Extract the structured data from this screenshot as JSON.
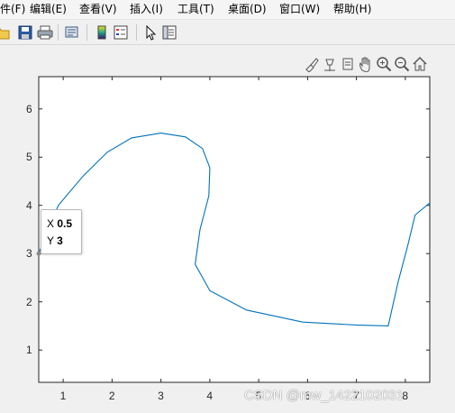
{
  "menu": [
    {
      "label": "件(F)"
    },
    {
      "label": "编辑(E)"
    },
    {
      "label": "查看(V)"
    },
    {
      "label": "插入(I)"
    },
    {
      "label": "工具(T)"
    },
    {
      "label": "桌面(D)"
    },
    {
      "label": "窗口(W)"
    },
    {
      "label": "帮助(H)"
    }
  ],
  "toolbar": {
    "icons": [
      "open-folder-icon",
      "save-icon",
      "print-icon",
      "print-preview-icon",
      "colorbar-icon",
      "legend-icon",
      "pointer-icon",
      "property-editor-icon"
    ]
  },
  "axes_toolbar": {
    "icons": [
      "brush-icon",
      "data-tips-icon",
      "link-icon",
      "pan-icon",
      "zoom-in-icon",
      "zoom-out-icon",
      "home-icon"
    ]
  },
  "datatip": {
    "x_label": "X",
    "x_value": "0.5",
    "y_label": "Y",
    "y_value": "3"
  },
  "watermark": "CSDN @mw_1422102031",
  "chart_data": {
    "type": "line",
    "x": [
      0.5,
      0.9,
      1.4,
      1.9,
      2.4,
      3.0,
      3.5,
      3.85,
      4.0,
      3.98,
      3.8,
      3.7,
      4.0,
      4.75,
      5.9,
      7.0,
      7.65,
      7.85,
      8.05,
      8.2,
      8.7,
      9.3
    ],
    "y": [
      3,
      4,
      4.6,
      5.1,
      5.4,
      5.5,
      5.42,
      5.18,
      4.78,
      4.2,
      3.5,
      2.78,
      2.23,
      1.83,
      1.58,
      1.52,
      1.5,
      2.4,
      3.17,
      3.8,
      4.22,
      4.5
    ],
    "series": [
      {
        "color": "#0072bd"
      }
    ],
    "xlim": [
      0.5,
      8.5
    ],
    "ylim": [
      0.33,
      6.67
    ],
    "xticks": [
      "1",
      "2",
      "3",
      "4",
      "5",
      "6",
      "7",
      "8"
    ],
    "yticks": [
      "1",
      "2",
      "3",
      "4",
      "5",
      "6"
    ],
    "title": "",
    "xlabel": "",
    "ylabel": ""
  }
}
